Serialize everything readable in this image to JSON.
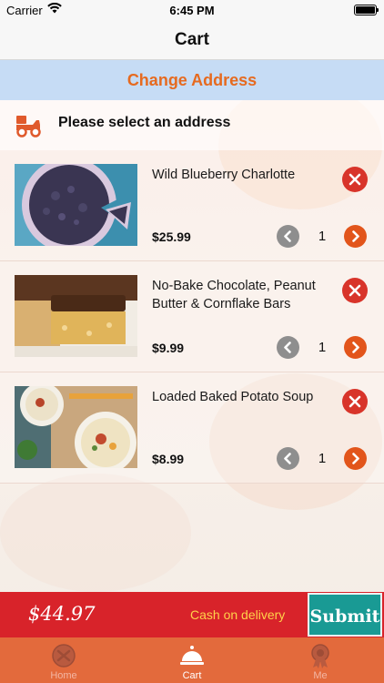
{
  "status_bar": {
    "carrier": "Carrier",
    "time": "6:45 PM"
  },
  "nav": {
    "title": "Cart"
  },
  "change_address": {
    "label": "Change Address"
  },
  "address_prompt": {
    "label": "Please select an address",
    "icon": "delivery-scooter-icon"
  },
  "cart": {
    "items": [
      {
        "name": "Wild Blueberry Charlotte",
        "price": "$25.99",
        "quantity": "1"
      },
      {
        "name": "No-Bake Chocolate, Peanut Butter & Cornflake Bars",
        "price": "$9.99",
        "quantity": "1"
      },
      {
        "name": "Loaded Baked Potato Soup",
        "price": "$8.99",
        "quantity": "1"
      }
    ]
  },
  "checkout": {
    "total": "$44.97",
    "payment_method": "Cash on delivery",
    "submit_label": "Submit"
  },
  "tabs": [
    {
      "label": "Home",
      "icon": "home-icon",
      "active": false
    },
    {
      "label": "Cart",
      "icon": "cloche-icon",
      "active": true
    },
    {
      "label": "Me",
      "icon": "profile-badge-icon",
      "active": false
    }
  ],
  "colors": {
    "accent": "#e66a1f",
    "remove": "#d8342a",
    "increment": "#e2551b",
    "checkout_bar": "#d8232a",
    "submit": "#199a94",
    "tab_bar": "#e36a3c"
  }
}
